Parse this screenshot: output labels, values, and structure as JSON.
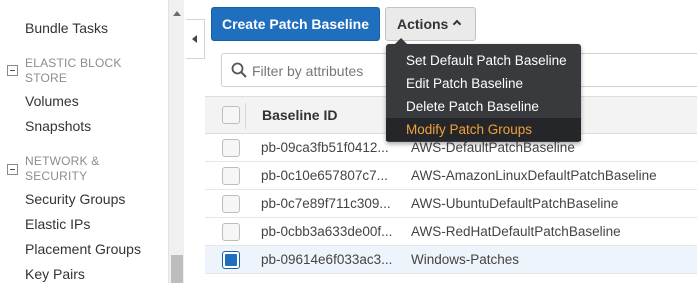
{
  "sidebar": {
    "top_item": "Bundle Tasks",
    "sections": [
      {
        "title": "ELASTIC BLOCK STORE",
        "items": [
          "Volumes",
          "Snapshots"
        ]
      },
      {
        "title": "NETWORK & SECURITY",
        "items": [
          "Security Groups",
          "Elastic IPs",
          "Placement Groups",
          "Key Pairs"
        ]
      }
    ]
  },
  "toolbar": {
    "create_label": "Create Patch Baseline",
    "actions_label": "Actions"
  },
  "filter": {
    "placeholder": "Filter by attributes"
  },
  "table": {
    "header_baseline_id": "Baseline ID",
    "rows": [
      {
        "id": "pb-09ca3fb51f0412...",
        "name": "AWS-DefaultPatchBaseline",
        "selected": false
      },
      {
        "id": "pb-0c10e657807c7...",
        "name": "AWS-AmazonLinuxDefaultPatchBaseline",
        "selected": false
      },
      {
        "id": "pb-0c7e89f711c309...",
        "name": "AWS-UbuntuDefaultPatchBaseline",
        "selected": false
      },
      {
        "id": "pb-0cbb3a633de00f...",
        "name": "AWS-RedHatDefaultPatchBaseline",
        "selected": false
      },
      {
        "id": "pb-09614e6f033ac3...",
        "name": "Windows-Patches",
        "selected": true
      }
    ]
  },
  "actions_menu": {
    "items": [
      {
        "label": "Set Default Patch Baseline",
        "active": false
      },
      {
        "label": "Edit Patch Baseline",
        "active": false
      },
      {
        "label": "Delete Patch Baseline",
        "active": false
      },
      {
        "label": "Modify Patch Groups",
        "active": true
      }
    ]
  },
  "colors": {
    "primary_button": "#1f6fbe",
    "menu_background": "#383a3e",
    "menu_active_text": "#f0a23b"
  },
  "icons": {
    "search": "search-icon",
    "collapse_panel": "chevron-left-icon",
    "actions_caret": "chevron-up-icon"
  }
}
